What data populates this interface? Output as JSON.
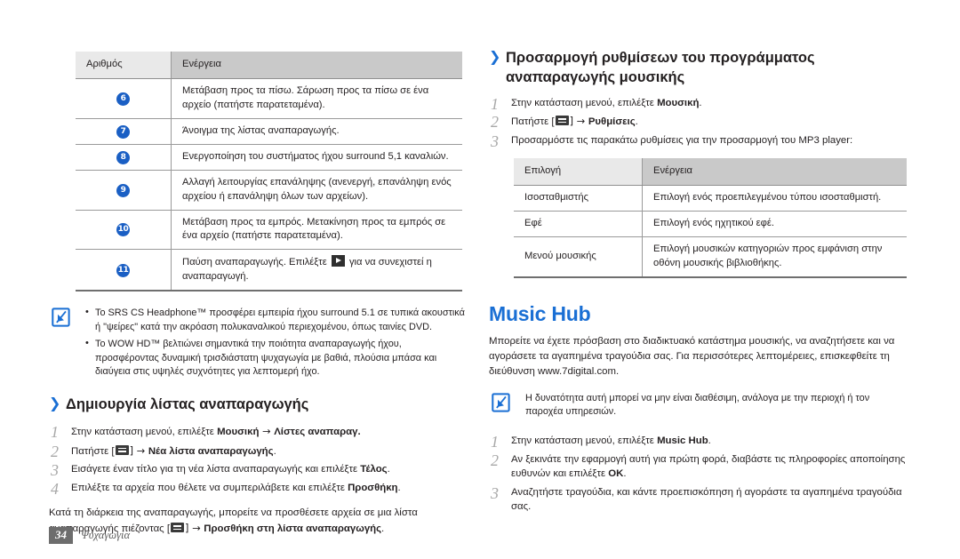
{
  "colors": {
    "accent_blue": "#1a6fd4",
    "badge_blue": "#1a5fc4",
    "table_header_light": "#e9e9e9",
    "table_header_dark": "#c9c9c9",
    "text": "#231f20",
    "step_number_gray": "#a8a8a8"
  },
  "left_column": {
    "table": {
      "headers": [
        "Αριθμός",
        "Ενέργεια"
      ],
      "rows": [
        {
          "num": "6",
          "action": "Μετάβαση προς τα πίσω. Σάρωση προς τα πίσω σε ένα αρχείο (πατήστε παρατεταμένα)."
        },
        {
          "num": "7",
          "action": "Άνοιγμα της λίστας αναπαραγωγής."
        },
        {
          "num": "8",
          "action": "Ενεργοποίηση του συστήματος ήχου surround 5,1 καναλιών."
        },
        {
          "num": "9",
          "action": "Αλλαγή λειτουργίας επανάληψης (ανενεργή, επανάληψη ενός αρχείου ή επανάληψη όλων των αρχείων)."
        },
        {
          "num": "10",
          "action": "Μετάβαση προς τα εμπρός. Μετακίνηση προς τα εμπρός σε ένα αρχείο (πατήστε παρατεταμένα)."
        },
        {
          "num": "11",
          "action_before": "Παύση αναπαραγωγής. Επιλέξτε",
          "action_after": "για να συνεχιστεί η αναπαραγωγή."
        }
      ]
    },
    "note": {
      "items": [
        "Το SRS CS Headphone™ προσφέρει εμπειρία ήχου surround 5.1 σε τυπικά ακουστικά ή \"ψείρες\" κατά την ακρόαση πολυκαναλικού περιεχομένου, όπως ταινίες DVD.",
        "Το WOW HD™ βελτιώνει σημαντικά την ποιότητα αναπαραγωγής ήχου, προσφέροντας δυναμική τρισδιάστατη ψυχαγωγία με βαθιά, πλούσια μπάσα και διαύγεια στις υψηλές συχνότητες για λεπτομερή ήχο."
      ]
    },
    "section": {
      "heading": "Δημιουργία λίστας αναπαραγωγής",
      "chevron": "❯",
      "steps": [
        {
          "n": "1",
          "pre": "Στην κατάσταση μενού, επιλέξτε ",
          "b1": "Μουσική",
          "arrow": " → ",
          "b2": "Λίστες αναπαραγ.",
          "post": ""
        },
        {
          "n": "2",
          "pre": "Πατήστε [",
          "key": "menu-key",
          "mid": "] → ",
          "b1": "Νέα λίστα αναπαραγωγής",
          "post": "."
        },
        {
          "n": "3",
          "pre": "Εισάγετε έναν τίτλο για τη νέα λίστα αναπαραγωγής και επιλέξτε ",
          "b1": "Τέλος",
          "post": "."
        },
        {
          "n": "4",
          "pre": "Επιλέξτε τα αρχεία που θέλετε να συμπεριλάβετε και επιλέξτε ",
          "b1": "Προσθήκη",
          "post": "."
        }
      ],
      "trailing_pre": "Κατά τη διάρκεια της αναπαραγωγής, μπορείτε να προσθέσετε αρχεία σε μια λίστα αναπαραγωγής πιέζοντας [",
      "trailing_mid": "] → ",
      "trailing_bold": "Προσθήκη στη λίστα αναπαραγωγής",
      "trailing_post": "."
    }
  },
  "right_column": {
    "section": {
      "chevron": "❯",
      "heading_line1": "Προσαρμογή ρυθμίσεων του προγράμματος",
      "heading_line2": "αναπαραγωγής μουσικής",
      "steps": [
        {
          "n": "1",
          "pre": "Στην κατάσταση μενού, επιλέξτε ",
          "b1": "Μουσική",
          "post": "."
        },
        {
          "n": "2",
          "pre": "Πατήστε [",
          "key": "menu-key",
          "mid": "] → ",
          "b1": "Ρυθμίσεις",
          "post": "."
        },
        {
          "n": "3",
          "pre": "Προσαρμόστε τις παρακάτω ρυθμίσεις για την προσαρμογή του MP3 player:",
          "b1": "",
          "post": ""
        }
      ]
    },
    "table": {
      "headers": [
        "Επιλογή",
        "Ενέργεια"
      ],
      "rows": [
        {
          "option": "Ισοσταθμιστής",
          "action": "Επιλογή ενός προεπιλεγμένου τύπου ισοσταθμιστή."
        },
        {
          "option": "Εφέ",
          "action": "Επιλογή ενός ηχητικού εφέ."
        },
        {
          "option": "Μενού μουσικής",
          "action": "Επιλογή μουσικών κατηγοριών προς εμφάνιση στην οθόνη μουσικής βιβλιοθήκης."
        }
      ]
    },
    "hub": {
      "heading": "Music Hub",
      "body": "Μπορείτε να έχετε πρόσβαση στο διαδικτυακό κατάστημα μουσικής, να αναζητήσετε και να αγοράσετε τα αγαπημένα τραγούδια σας. Για περισσότερες λεπτομέρειες, επισκεφθείτε τη διεύθυνση www.7digital.com.",
      "note": "Η δυνατότητα αυτή μπορεί να μην είναι διαθέσιμη, ανάλογα με την περιοχή ή τον παροχέα υπηρεσιών.",
      "steps": [
        {
          "n": "1",
          "pre": "Στην κατάσταση μενού, επιλέξτε ",
          "b1": "Music Hub",
          "post": "."
        },
        {
          "n": "2",
          "pre": "Αν ξεκινάτε την εφαρμογή αυτή για πρώτη φορά, διαβάστε τις πληροφορίες αποποίησης ευθυνών και επιλέξτε ",
          "b1": "OK",
          "post": "."
        },
        {
          "n": "3",
          "pre": "Αναζητήστε τραγούδια, και κάντε προεπισκόπηση ή αγοράστε τα αγαπημένα τραγούδια σας.",
          "b1": "",
          "post": ""
        }
      ]
    }
  },
  "footer": {
    "page_number": "34",
    "chapter": "Ψυχαγωγία"
  }
}
